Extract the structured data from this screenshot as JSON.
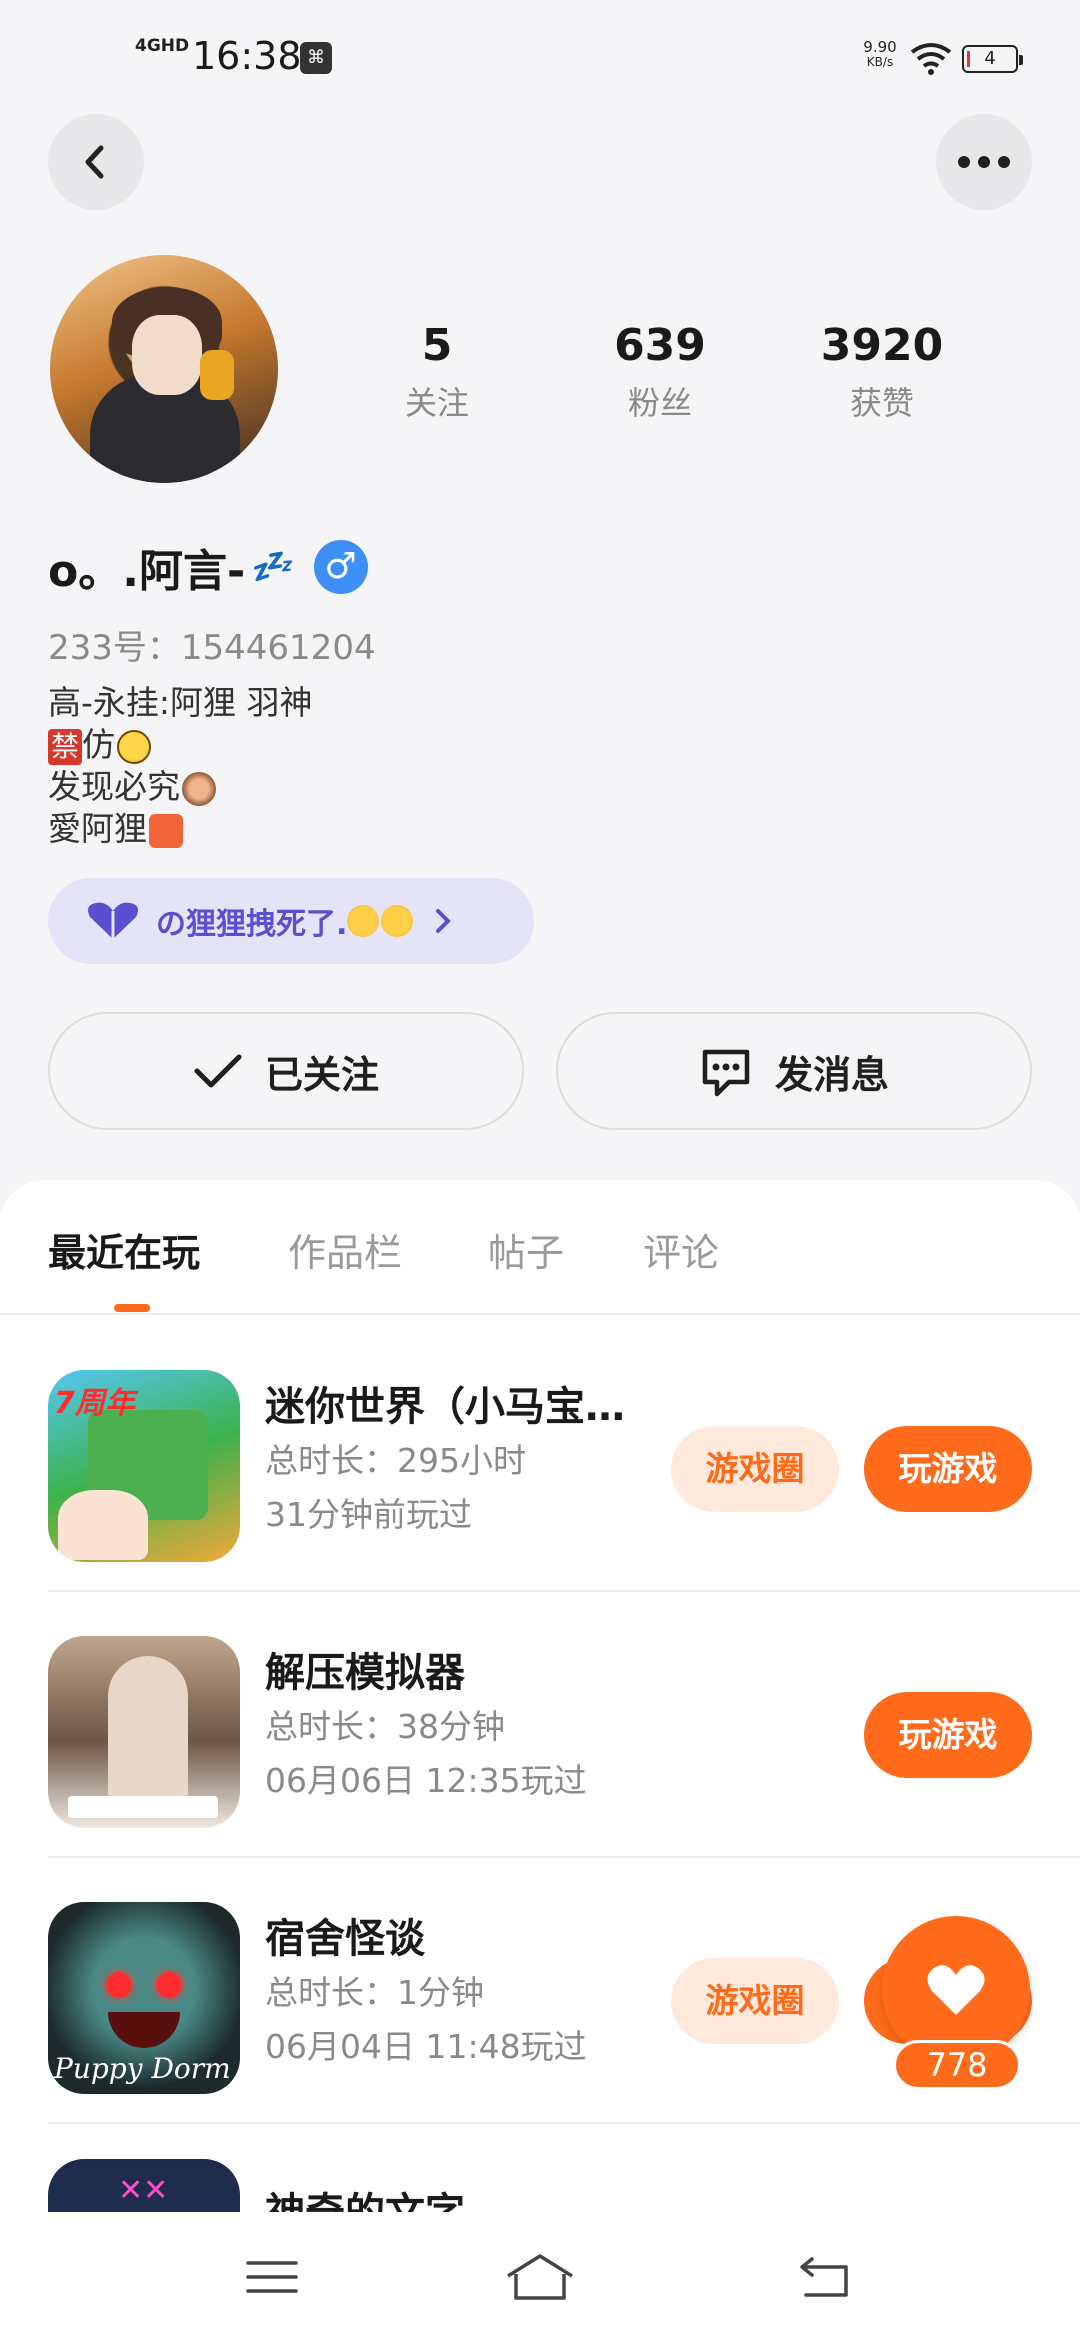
{
  "status_bar": {
    "network": "4GHD",
    "time": "16:38",
    "speed_value": "9.90",
    "speed_unit": "KB/s",
    "battery": "4"
  },
  "profile": {
    "name": "o。.阿言-",
    "zzz": "💤",
    "gender_symbol": "♂",
    "uid": "233号：154461204",
    "stats": [
      {
        "value": "5",
        "label": "关注"
      },
      {
        "value": "639",
        "label": "粉丝"
      },
      {
        "value": "3920",
        "label": "获赞"
      }
    ],
    "bio": {
      "line1": "高-永挂:阿狸 羽神",
      "line2_tag": "禁",
      "line2_text": "仿",
      "line3": "发现必究",
      "line4": "愛阿狸"
    },
    "group_name": "の狸狸拽死了."
  },
  "actions": {
    "followed_label": "已关注",
    "message_label": "发消息"
  },
  "tabs": [
    "最近在玩",
    "作品栏",
    "帖子",
    "评论"
  ],
  "games": [
    {
      "name": "迷你世界（小马宝莉联动）",
      "duration": "总时长：295小时",
      "last_played": "31分钟前玩过",
      "circle_label": "游戏圈",
      "play_label": "玩游戏",
      "icon_badge": "7周年"
    },
    {
      "name": "解压模拟器",
      "duration": "总时长：38分钟",
      "last_played": "06月06日 12:35玩过",
      "play_label": "玩游戏"
    },
    {
      "name": "宿舍怪谈",
      "duration": "总时长：1分钟",
      "last_played": "06月04日 11:48玩过",
      "circle_label": "游戏圈",
      "play_label": "玩游戏",
      "icon_text": "Puppy Dorm"
    },
    {
      "name": "神奇的文字"
    }
  ],
  "like": {
    "count": "778"
  },
  "colors": {
    "accent": "#ff6b1a",
    "accent_soft": "#ffe9dc",
    "group_text": "#5a4fcf",
    "gender_blue": "#3d8ff5"
  },
  "icons": [
    "back-arrow-icon",
    "more-dots-icon",
    "checkmark-icon",
    "chat-bubble-icon",
    "heart-icon",
    "chevron-right-icon",
    "menu-icon",
    "home-icon",
    "back-nav-icon"
  ]
}
